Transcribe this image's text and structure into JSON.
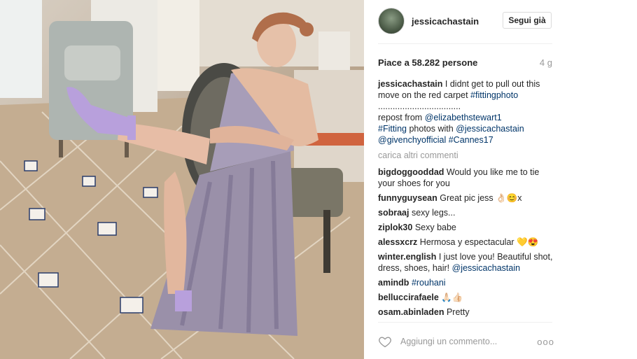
{
  "post": {
    "username": "jessicachastain",
    "follow_label": "Segui già",
    "likes": "Piace a 58.282 persone",
    "age": "4 g"
  },
  "caption": {
    "user": "jessicachastain",
    "text1": " I didnt get to pull out this move on the red carpet ",
    "tag_fittingphoto": "#fittingphoto",
    "dots": "..................................",
    "text2": "repost from ",
    "mention_elizabeth": "@elizabethstewart1",
    "tag_fitting": "#Fitting",
    "text3": " photos with ",
    "mention_jessica": "@jessicachastain",
    "mention_givenchy": "@givenchyofficial",
    "tag_cannes": "#Cannes17"
  },
  "load_more": "carica altri commenti",
  "comments": [
    {
      "user": "bigdoggooddad",
      "text": "Would you like me to tie your shoes for you"
    },
    {
      "user": "funnyguysean",
      "text": "Great pic jess 👌🏻😊x"
    },
    {
      "user": "sobraaj",
      "text": "sexy legs..."
    },
    {
      "user": "ziplok30",
      "text": "Sexy babe"
    },
    {
      "user": "alessxcrz",
      "text": "Hermosa y espectacular 💛😍"
    },
    {
      "user": "winter.english",
      "text": "I just love you! Beautiful shot, dress, shoes, hair! ",
      "link": "@jessicachastain"
    },
    {
      "user": "amindb",
      "link": "#rouhani"
    },
    {
      "user": "belluccirafaele",
      "text": "🙏🏻👍🏻"
    },
    {
      "user": "osam.abinladen",
      "text": "Pretty"
    }
  ],
  "footer": {
    "placeholder": "Aggiungi un commento...",
    "more": "ooo"
  },
  "icons": {
    "heart": "heart-outline-icon",
    "more": "more-options-icon"
  }
}
